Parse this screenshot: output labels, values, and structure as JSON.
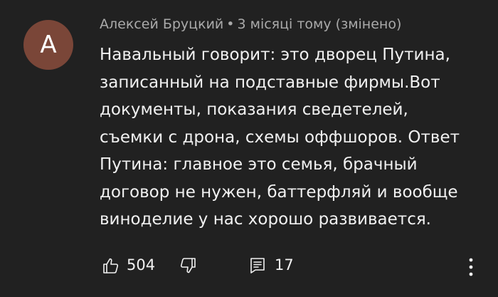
{
  "comment": {
    "avatar_letter": "A",
    "author": "Алексей Бруцкий",
    "separator": "•",
    "meta": "3 місяці тому (змінено)",
    "text_lines": [
      "Навальный говорит: это дворец Путина,",
      "записанный на подставные фирмы.Вот",
      "документы, показания сведетелей,",
      "съемки с дрона, схемы оффшоров. Ответ",
      "Путина: главное это семья, брачный",
      "договор не нужен, баттерфляй и вообще",
      "виноделие у нас хорошо развивается."
    ],
    "likes": "504",
    "replies": "17"
  },
  "icons": {
    "like": "thumb-up-icon",
    "dislike": "thumb-down-icon",
    "reply": "comment-icon",
    "more": "more-vertical-icon"
  },
  "colors": {
    "background": "#212121",
    "avatar": "#7a4638",
    "text": "#f1f1f1",
    "meta": "#aaaaaa"
  }
}
